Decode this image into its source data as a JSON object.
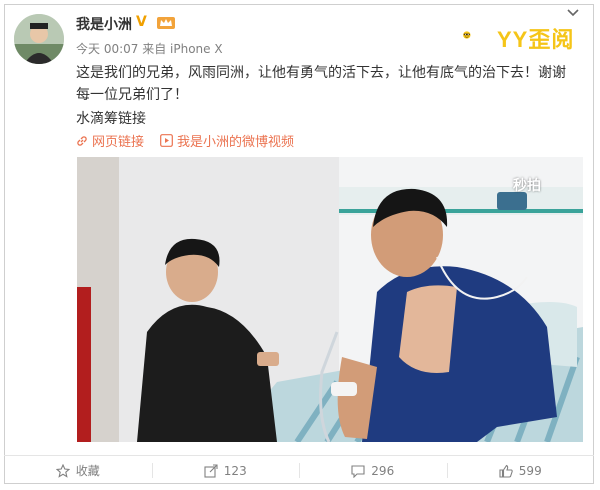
{
  "post": {
    "username": "我是小洲",
    "verified_badge": "V",
    "meta": "今天 00:07 来自 iPhone X",
    "text": "这是我们的兄弟，风雨同洲，让他有勇气的活下去，让他有底气的治下去！谢谢每一位兄弟们了！",
    "fundraiser": "水滴筹链接",
    "link_web": "网页链接",
    "link_video": "我是小洲的微博视频"
  },
  "brand": {
    "name": "YY歪阅",
    "color": "#f5c518"
  },
  "video": {
    "watermark": "秒拍"
  },
  "actions": {
    "favorite": "收藏",
    "repost": "123",
    "comment": "296",
    "like": "599"
  },
  "colors": {
    "link": "#eb7350",
    "badge": "#f0a000",
    "muted": "#808080"
  }
}
